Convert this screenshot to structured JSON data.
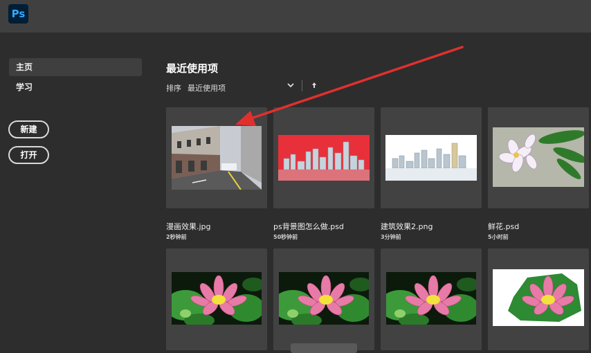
{
  "app": {
    "logo_text": "Ps",
    "accent_color": "#31a8ff",
    "annotation_color": "#e0302e"
  },
  "sidebar": {
    "items": [
      {
        "label": "主页",
        "active": true
      },
      {
        "label": "学习",
        "active": false
      }
    ],
    "buttons": {
      "new_label": "新建",
      "open_label": "打开"
    }
  },
  "main": {
    "title": "最近使用项",
    "sort": {
      "label": "排序",
      "value": "最近使用项",
      "direction_icon": "arrow-up-icon",
      "dropdown_icon": "chevron-down-icon"
    },
    "files": [
      {
        "name": "漫画效果.jpg",
        "time": "2秒钟前",
        "thumb": "street"
      },
      {
        "name": "ps背景图怎么做.psd",
        "time": "50秒钟前",
        "thumb": "city-red"
      },
      {
        "name": "建筑效果2.png",
        "time": "3分钟前",
        "thumb": "city-white"
      },
      {
        "name": "鲜花.psd",
        "time": "5小时前",
        "thumb": "plumeria"
      },
      {
        "name": "",
        "time": "",
        "thumb": "lotus"
      },
      {
        "name": "",
        "time": "",
        "thumb": "lotus"
      },
      {
        "name": "",
        "time": "",
        "thumb": "lotus"
      },
      {
        "name": "",
        "time": "",
        "thumb": "lotus-cutout"
      }
    ]
  }
}
